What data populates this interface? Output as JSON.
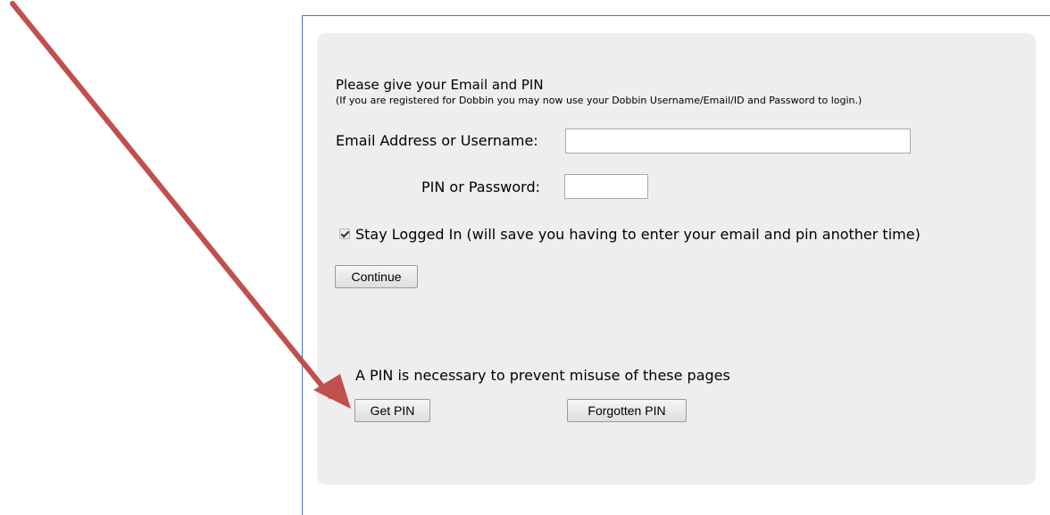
{
  "form": {
    "heading": "Please give your Email and PIN",
    "subnote": "(If you are registered for Dobbin you may now use your Dobbin Username/Email/ID and Password to login.)",
    "email_label": "Email Address or Username:",
    "email_value": "",
    "pin_label": "PIN or Password:",
    "pin_value": "",
    "stay_logged_in_label": "Stay Logged In (will save you having to enter your email and pin another time)",
    "stay_logged_in_checked": true,
    "continue_label": "Continue"
  },
  "pin_section": {
    "note": "A PIN is necessary to prevent misuse of these pages",
    "get_pin_label": "Get PIN",
    "forgotten_pin_label": "Forgotten PIN"
  },
  "annotation": {
    "arrow_color": "#c0504d"
  }
}
